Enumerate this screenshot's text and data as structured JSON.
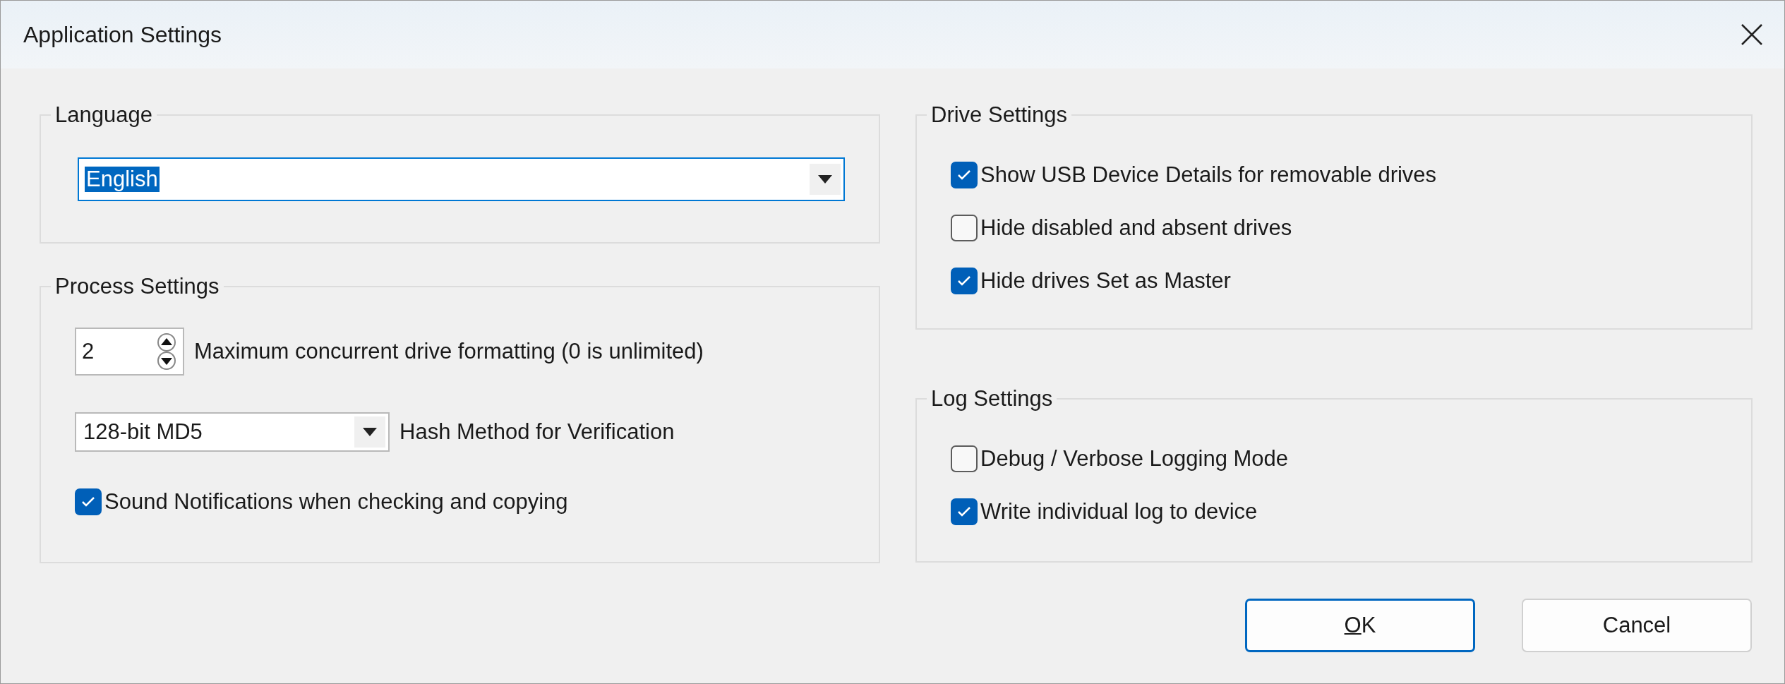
{
  "window": {
    "title": "Application Settings"
  },
  "left_groups": [
    {
      "title": "Language",
      "controls": [
        {
          "kind": "combo",
          "selected_option": "English",
          "focused": true
        }
      ]
    },
    {
      "title": "Process Settings",
      "controls": [
        {
          "kind": "spinner",
          "value": "2",
          "label": "Maximum concurrent drive formatting (0 is unlimited)"
        },
        {
          "kind": "combo",
          "label": "Hash Method for Verification",
          "selected_option": "128-bit MD5",
          "focused": false
        },
        {
          "kind": "checkbox",
          "label": "Sound Notifications when checking and copying",
          "checked": true
        }
      ]
    }
  ],
  "right_groups": [
    {
      "title": "Drive Settings",
      "controls": [
        {
          "kind": "checkbox",
          "label": "Show USB Device Details for removable drives",
          "checked": true
        },
        {
          "kind": "checkbox",
          "label": "Hide disabled and absent drives",
          "checked": false
        },
        {
          "kind": "checkbox",
          "label": "Hide drives Set as Master",
          "checked": true
        }
      ]
    },
    {
      "title": "Log Settings",
      "controls": [
        {
          "kind": "checkbox",
          "label": "Debug / Verbose Logging Mode",
          "checked": false
        },
        {
          "kind": "checkbox",
          "label": "Write individual log to device",
          "checked": true
        }
      ]
    }
  ],
  "buttons": [
    {
      "label": "OK",
      "default": true,
      "first_letter_underlined": true
    },
    {
      "label": "Cancel",
      "default": false
    }
  ]
}
